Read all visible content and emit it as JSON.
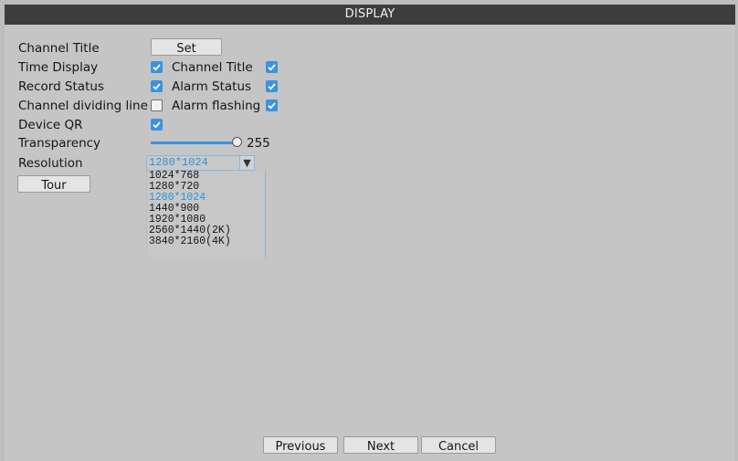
{
  "window": {
    "title": "DISPLAY"
  },
  "form": {
    "channel_title_label": "Channel Title",
    "set_button": "Set",
    "time_display_label": "Time Display",
    "channel_title_check_label": "Channel Title",
    "record_status_label": "Record Status",
    "alarm_status_label": "Alarm Status",
    "channel_dividing_label": "Channel dividing line",
    "alarm_flashing_label": "Alarm flashing",
    "device_qr_label": "Device QR",
    "transparency_label": "Transparency",
    "transparency_value": "255",
    "resolution_label": "Resolution",
    "tour_button": "Tour"
  },
  "checkboxes": {
    "time_display": true,
    "channel_title": true,
    "record_status": true,
    "alarm_status": true,
    "channel_dividing_line": false,
    "alarm_flashing": true,
    "device_qr": true
  },
  "resolution": {
    "selected": "1280*1024",
    "options": [
      "1024*768",
      "1280*720",
      "1280*1024",
      "1440*900",
      "1920*1080",
      "2560*1440(2K)",
      "3840*2160(4K)"
    ]
  },
  "footer": {
    "previous": "Previous",
    "next": "Next",
    "cancel": "Cancel"
  },
  "colors": {
    "accent": "#3a93e0",
    "titlebar": "#3d3d3f",
    "background": "#c5c5c5"
  }
}
